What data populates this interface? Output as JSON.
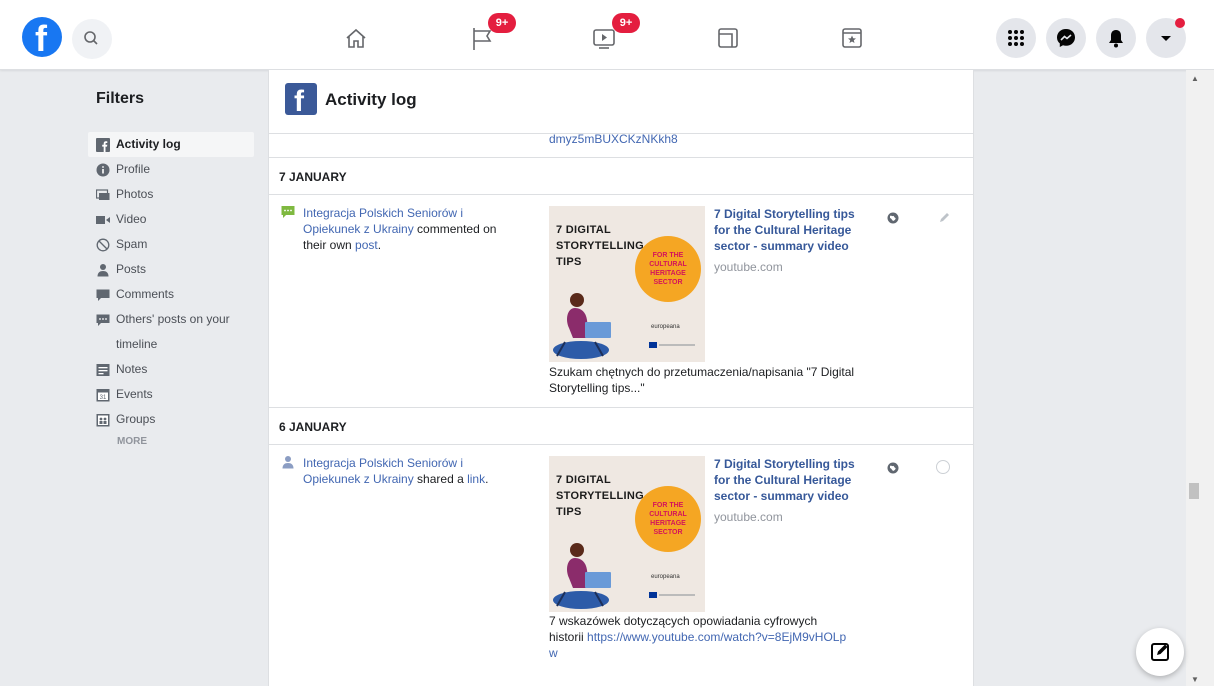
{
  "topbar": {
    "logo_letter": "f",
    "nav": [
      {
        "name": "home",
        "badge": ""
      },
      {
        "name": "pages",
        "badge": "9+"
      },
      {
        "name": "watch",
        "badge": "9+"
      },
      {
        "name": "gaming",
        "badge": ""
      },
      {
        "name": "marketplace",
        "badge": ""
      }
    ],
    "right_buttons": [
      "menu",
      "messenger",
      "notifications",
      "account"
    ]
  },
  "filters": {
    "title": "Filters",
    "items": [
      {
        "label": "Activity log",
        "icon": "facebook-square-icon",
        "active": true
      },
      {
        "label": "Profile",
        "icon": "info-icon"
      },
      {
        "label": "Photos",
        "icon": "photos-icon"
      },
      {
        "label": "Video",
        "icon": "video-icon"
      },
      {
        "label": "Spam",
        "icon": "block-icon"
      },
      {
        "label": "Posts",
        "icon": "person-icon"
      },
      {
        "label": "Comments",
        "icon": "comment-icon"
      },
      {
        "label": "Others' posts on your timeline",
        "icon": "chat-bubble-icon"
      },
      {
        "label": "Notes",
        "icon": "notes-icon"
      },
      {
        "label": "Events",
        "icon": "calendar-icon"
      },
      {
        "label": "Groups",
        "icon": "groups-icon"
      }
    ],
    "more": "MORE"
  },
  "panel": {
    "logo_letter": "f",
    "title": "Activity log",
    "cut_off_link": "dmyz5mBUXCKzNKkh8",
    "sections": [
      {
        "date": "7 JANUARY",
        "entry": {
          "actor_line1": "Integracja Polskich Seniorów i",
          "actor_line2": "Opiekunek z Ukrainy",
          "action": " commented on",
          "line3_text": "their own ",
          "line3_link": "post",
          "line3_end": ".",
          "link_title": "7 Digital Storytelling tips for the Cultural Heritage sector - summary video",
          "link_domain": "youtube.com",
          "caption": "Szukam chętnych do przetumaczenia/napisania \"7 Digital Storytelling tips...\""
        }
      },
      {
        "date": "6 JANUARY",
        "entry": {
          "actor_line1": "Integracja Polskich Seniorów i",
          "actor_line2": "Opiekunek z Ukrainy",
          "action": " shared a ",
          "action_link": "link",
          "action_end": ".",
          "link_title": "7 Digital Storytelling tips for the Cultural Heritage sector - summary video",
          "link_domain": "youtube.com",
          "caption_text": "7 wskazówek dotyczących opowiadania cyfrowych historii ",
          "caption_link": "https://www.youtube.com/watch?v=8EjM9vHOLpw"
        }
      }
    ],
    "thumbnail": {
      "title_line1": "7 DIGITAL",
      "title_line2": "STORYTELLING",
      "title_line3": "TIPS",
      "circle_text": "FOR THE CULTURAL HERITAGE SECTOR",
      "brand": "europeana"
    }
  },
  "colors": {
    "brand_blue": "#1877f2",
    "link_blue": "#4267b2",
    "badge_red": "#e41e3f",
    "thumb_orange": "#f5a623"
  }
}
